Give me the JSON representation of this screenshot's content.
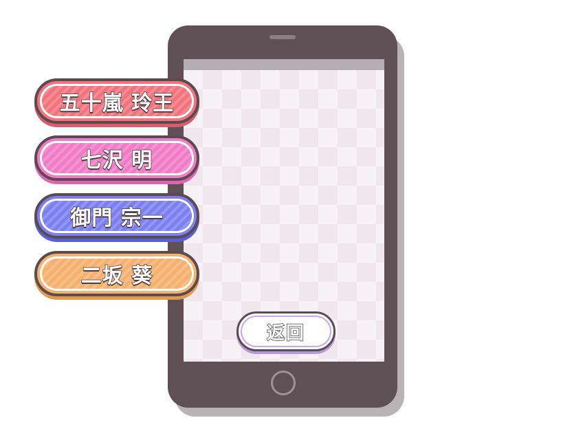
{
  "characters": [
    {
      "label": "五十嵐 玲王",
      "color": "#f2737c"
    },
    {
      "label": "七沢 明",
      "color": "#f07bc6"
    },
    {
      "label": "御門 宗一",
      "color": "#7b7ff0"
    },
    {
      "label": "二坂 葵",
      "color": "#f5b16e"
    }
  ],
  "back_button": {
    "label": "返回",
    "border_color": "#c9a7f0"
  },
  "device": {
    "body_color": "#5f5056",
    "screen_color": "#f5f0f3"
  }
}
